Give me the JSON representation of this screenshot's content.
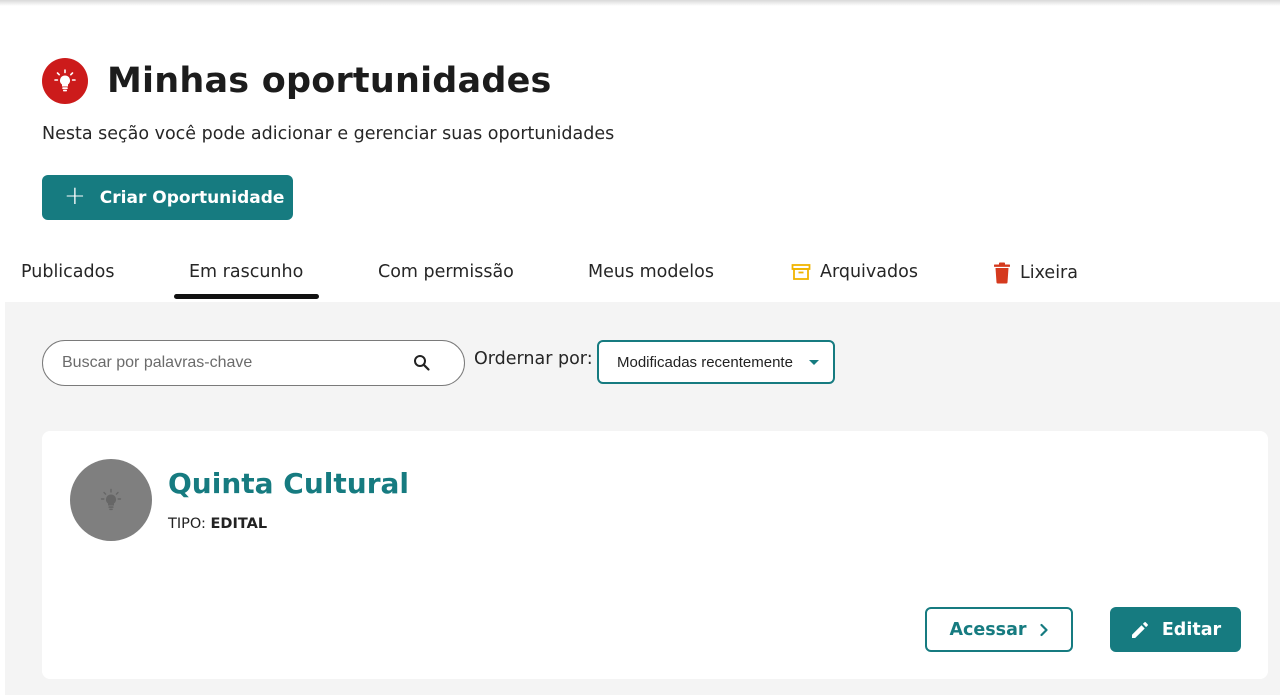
{
  "header": {
    "title": "Minhas oportunidades",
    "subtitle": "Nesta seção você pode adicionar e gerenciar suas oportunidades",
    "create_button": "Criar Oportunidade"
  },
  "tabs": [
    {
      "label": "Publicados",
      "active": false
    },
    {
      "label": "Em rascunho",
      "active": true
    },
    {
      "label": "Com permissão",
      "active": false
    },
    {
      "label": "Meus modelos",
      "active": false
    },
    {
      "label": "Arquivados",
      "icon": "archive-icon",
      "active": false
    },
    {
      "label": "Lixeira",
      "icon": "trash-icon",
      "active": false
    }
  ],
  "filters": {
    "search_placeholder": "Buscar por palavras-chave",
    "order_label": "Ordernar por:",
    "order_value": "Modificadas recentemente"
  },
  "card": {
    "title": "Quinta Cultural",
    "type_label": "TIPO:",
    "type_value": "EDITAL",
    "access_button": "Acessar",
    "edit_button": "Editar"
  },
  "colors": {
    "primary": "#167b80",
    "brand_red": "#cc1b1b",
    "archive_yellow": "#f0b400",
    "trash_red": "#d53a1e",
    "content_bg": "#f4f4f4"
  }
}
